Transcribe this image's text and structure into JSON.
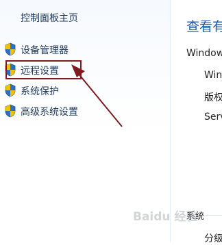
{
  "left_pane": {
    "home_link": "控制面板主页",
    "items": [
      {
        "label": "设备管理器",
        "icon": "shield-icon"
      },
      {
        "label": "远程设置",
        "icon": "shield-icon"
      },
      {
        "label": "系统保护",
        "icon": "shield-icon"
      },
      {
        "label": "高级系统设置",
        "icon": "shield-icon"
      }
    ]
  },
  "right_pane": {
    "title": "查看有",
    "edition_heading": "Window",
    "lines": [
      "Win",
      "版权",
      "Serv"
    ],
    "system_section": "系统",
    "field_label": "分级"
  },
  "annotation": {
    "color": "#7d1b21"
  },
  "watermark": "Baidu 经验",
  "colors": {
    "link": "#1e395b",
    "title": "#1e5aa8",
    "shield_blue": "#2f6fc4",
    "shield_yellow": "#f2c200"
  }
}
